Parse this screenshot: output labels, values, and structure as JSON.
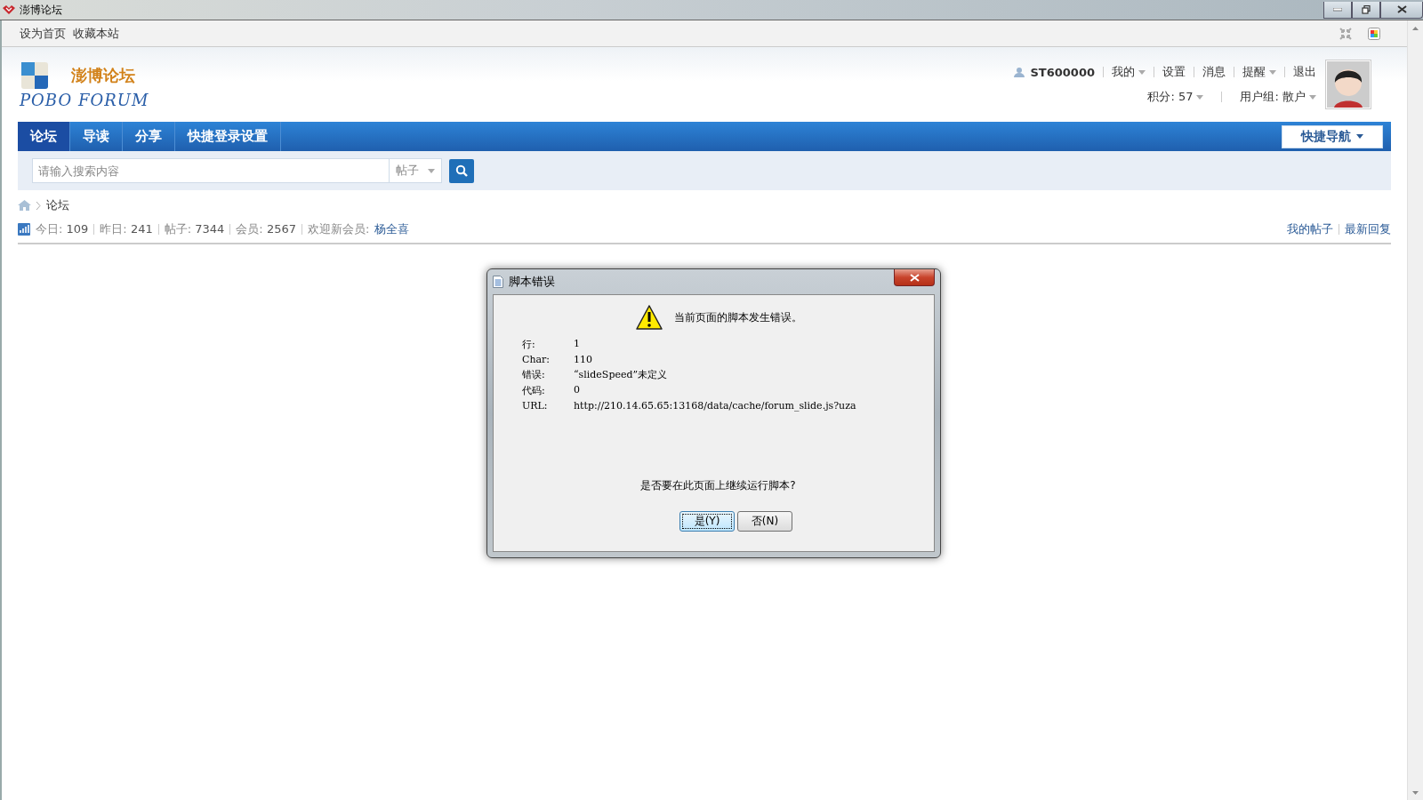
{
  "window": {
    "title": "澎博论坛"
  },
  "top_links": [
    "设为首页",
    "收藏本站"
  ],
  "logo": {
    "name": "澎博论坛",
    "subtitle": "POBO FORUM"
  },
  "user": {
    "name": "ST600000",
    "links": [
      {
        "label": "我的",
        "dropdown": true
      },
      {
        "label": "设置",
        "dropdown": false
      },
      {
        "label": "消息",
        "dropdown": false
      },
      {
        "label": "提醒",
        "dropdown": true
      },
      {
        "label": "退出",
        "dropdown": false
      }
    ],
    "info": [
      {
        "label": "积分:",
        "value": "57"
      },
      {
        "label": "用户组:",
        "value": "散户"
      }
    ]
  },
  "nav": {
    "tabs": [
      {
        "label": "论坛",
        "selected": true
      },
      {
        "label": "导读",
        "selected": false
      },
      {
        "label": "分享",
        "selected": false
      },
      {
        "label": "快捷登录设置",
        "selected": false
      }
    ],
    "quick_nav": "快捷导航"
  },
  "search": {
    "placeholder": "请输入搜索内容",
    "scope": "帖子"
  },
  "breadcrumb": [
    "论坛"
  ],
  "stats": [
    {
      "label": "今日:",
      "value": "109"
    },
    {
      "label": "昨日:",
      "value": "241"
    },
    {
      "label": "帖子:",
      "value": "7344"
    },
    {
      "label": "会员:",
      "value": "2567"
    }
  ],
  "new_member": {
    "label": "欢迎新会员:",
    "name": "杨全喜"
  },
  "right_links": [
    "我的帖子",
    "最新回复"
  ],
  "dialog": {
    "title": "脚本错误",
    "message": "当前页面的脚本发生错误。",
    "details": [
      {
        "label": "行:",
        "value": "1"
      },
      {
        "label": "Char:",
        "value": "110"
      },
      {
        "label": "错误:",
        "value": "“slideSpeed”未定义"
      },
      {
        "label": "代码:",
        "value": "0"
      },
      {
        "label": "URL:",
        "value": "http://210.14.65.65:13168/data/cache/forum_slide.js?uza"
      }
    ],
    "question": "是否要在此页面上继续运行脚本?",
    "buttons": [
      {
        "label": "是(Y)",
        "default": true
      },
      {
        "label": "否(N)",
        "default": false
      }
    ]
  }
}
